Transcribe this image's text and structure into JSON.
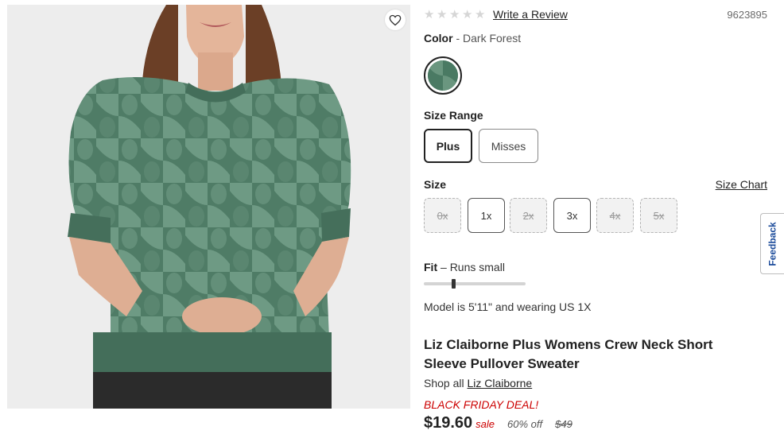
{
  "product_image": {
    "alt": "Woman wearing green patterned short-sleeve sweater",
    "favorite_icon": "heart-outline-icon"
  },
  "rating": {
    "star_count": 5,
    "filled_stars": 0,
    "star_icon": "star-icon",
    "review_link": "Write a Review",
    "sku": "9623895"
  },
  "color": {
    "label": "Color",
    "separator": " - ",
    "value": "Dark Forest",
    "swatch_color": "#4a7a63"
  },
  "size_range": {
    "label": "Size Range",
    "options": [
      {
        "label": "Plus",
        "selected": true
      },
      {
        "label": "Misses",
        "selected": false
      }
    ]
  },
  "size": {
    "label": "Size",
    "size_chart_link": "Size Chart",
    "options": [
      {
        "label": "0x",
        "available": false
      },
      {
        "label": "1x",
        "available": true
      },
      {
        "label": "2x",
        "available": false
      },
      {
        "label": "3x",
        "available": true
      },
      {
        "label": "4x",
        "available": false
      },
      {
        "label": "5x",
        "available": false
      }
    ]
  },
  "fit": {
    "label": "Fit",
    "separator": " – ",
    "value": "Runs small",
    "level": 0.27
  },
  "model_info": "Model is 5'11\" and wearing US 1X",
  "product_title": "Liz Claiborne Plus Womens Crew Neck Short Sleeve Pullover Sweater",
  "shop_all": {
    "prefix": "Shop all ",
    "brand": "Liz Claiborne"
  },
  "deal_text": "BLACK FRIDAY DEAL!",
  "pricing": {
    "price": "$19.60",
    "sale_label": "sale",
    "discount": "60% off",
    "original_price": "$49"
  },
  "feedback_tab": "Feedback",
  "colors": {
    "accent_red": "#cc0000",
    "text_dark": "#222222",
    "swatch_green": "#4a7a63"
  }
}
